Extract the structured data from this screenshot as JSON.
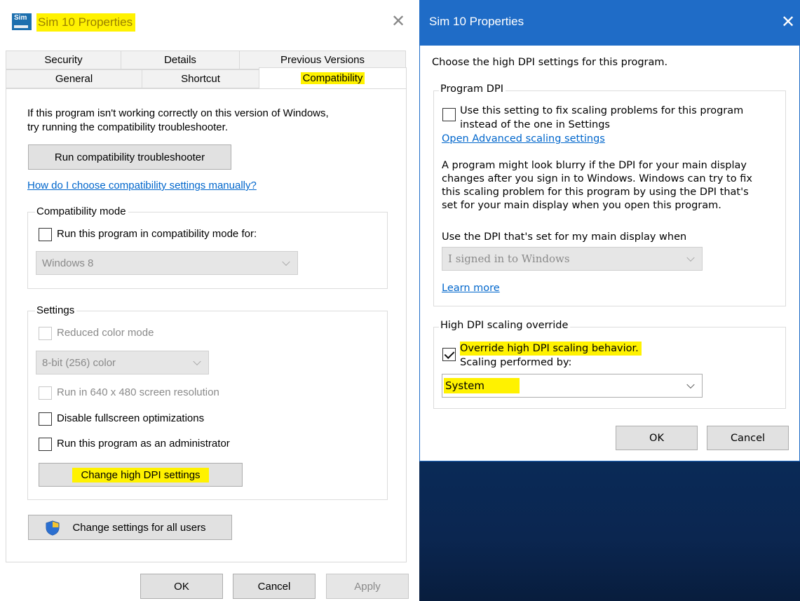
{
  "left": {
    "title": "Sim 10 Properties",
    "app_icon_text": "Sim",
    "close_glyph": "✕",
    "tabs_row1": [
      "Security",
      "Details",
      "Previous Versions"
    ],
    "tabs_row2": [
      "General",
      "Shortcut",
      "Compatibility"
    ],
    "active_tab": "Compatibility",
    "intro_text_line1": "If this program isn't working correctly on this version of Windows,",
    "intro_text_line2": "try running the compatibility troubleshooter.",
    "run_troubleshooter_label": "Run compatibility troubleshooter",
    "manual_link": "How do I choose compatibility settings manually?",
    "compat_mode": {
      "legend": "Compatibility mode",
      "checkbox_label": "Run this program in compatibility mode for:",
      "checked": false,
      "select_value": "Windows 8"
    },
    "settings": {
      "legend": "Settings",
      "reduced_color_label": "Reduced color mode",
      "color_select_value": "8-bit (256) color",
      "res_640_label": "Run in 640 x 480 screen resolution",
      "fullscreen_label": "Disable fullscreen optimizations",
      "admin_label": "Run this program as an administrator",
      "dpi_button_label": "Change high DPI settings"
    },
    "all_users_label": "Change settings for all users",
    "shield_icon": "uac-shield-icon",
    "ok_label": "OK",
    "cancel_label": "Cancel",
    "apply_label": "Apply"
  },
  "right": {
    "title": "Sim 10 Properties",
    "close_glyph": "✕",
    "heading": "Choose the high DPI settings for this program.",
    "program_dpi": {
      "legend": "Program DPI",
      "checkbox_line1": "Use this setting to fix scaling problems for this program",
      "checkbox_line2": "instead of the one in Settings",
      "checked": false,
      "advanced_link": "Open Advanced scaling settings",
      "para_line1": "A program might look blurry if the DPI for your main display",
      "para_line2": "changes after you sign in to Windows. Windows can try to fix",
      "para_line3": "this scaling problem for this program by using the DPI that's",
      "para_line4": "set for your main display when you open this program.",
      "use_dpi_label": "Use the DPI that's set for my main display when",
      "dpi_select_value": "I signed in to Windows",
      "learn_more_link": "Learn more"
    },
    "override": {
      "legend": "High DPI scaling override",
      "checkbox_label": "Override high DPI scaling behavior.",
      "checked": true,
      "scaling_label": "Scaling performed by:",
      "scaling_select_value": "System"
    },
    "ok_label": "OK",
    "cancel_label": "Cancel"
  },
  "colors": {
    "highlight": "#fff200",
    "titlebar_active": "#1f6cc7",
    "link": "#0066cc",
    "desktop": "#0a2a57"
  }
}
